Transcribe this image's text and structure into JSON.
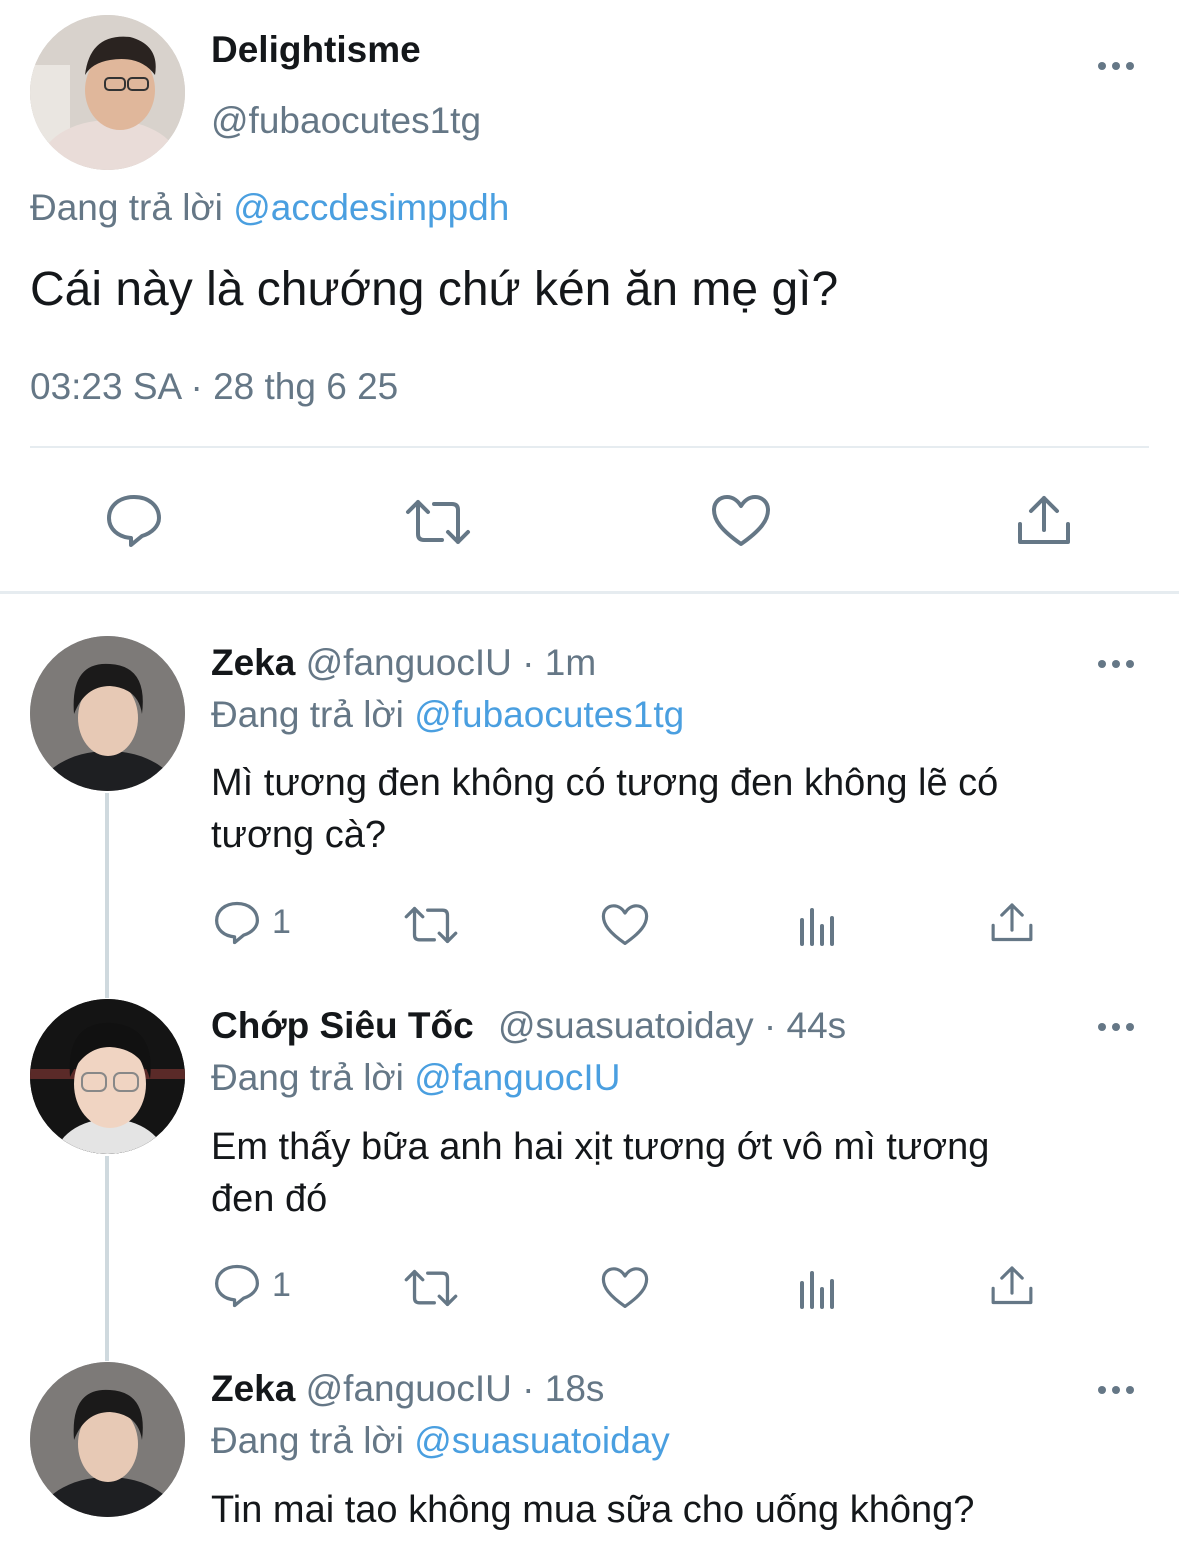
{
  "main_tweet": {
    "display_name": "Delightisme",
    "handle": "@fubaocutes1tg",
    "replying_prefix": "Đang trả lời",
    "replying_to": "@accdesimppdh",
    "text": "Cái này là chướng chứ kén ăn mẹ gì?",
    "timestamp": "03:23 SA · 28 thg 6 25"
  },
  "replies": [
    {
      "display_name": "Zeka",
      "handle": "@fanguocIU",
      "time": "· 1m",
      "replying_prefix": "Đang trả lời",
      "replying_to": "@fubaocutes1tg",
      "text_line1": "Mì tương đen không có tương đen không lẽ có",
      "text_line2": "tương cà?",
      "reply_count": "1"
    },
    {
      "display_name": "Chớp Siêu Tốc",
      "handle": "@suasuatoiday",
      "time": "· 44s",
      "replying_prefix": "Đang trả lời",
      "replying_to": "@fanguocIU",
      "text_line1": "Em thấy bữa anh hai xịt tương ớt vô mì tương",
      "text_line2": "đen đó",
      "reply_count": "1"
    },
    {
      "display_name": "Zeka",
      "handle": "@fanguocIU",
      "time": "· 18s",
      "replying_prefix": "Đang trả lời",
      "replying_to": "@suasuatoiday",
      "text_line1": "Tin mai tao không mua sữa cho uống không?"
    }
  ],
  "icons": {
    "reply": "speech-bubble-icon",
    "retweet": "retweet-arrows-icon",
    "like": "heart-icon",
    "views": "bar-chart-icon",
    "share": "share-upload-icon",
    "more": "more-dots-icon"
  },
  "colors": {
    "link": "#4a9fe0",
    "muted": "#657786",
    "text": "#14171a"
  }
}
